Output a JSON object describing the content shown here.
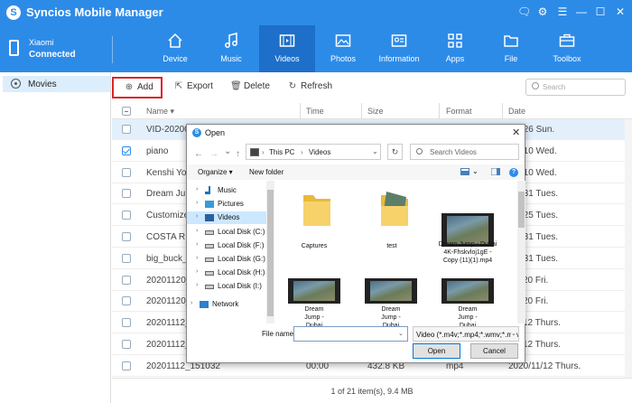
{
  "app": {
    "title": "Syncios Mobile Manager",
    "logo_letter": "S"
  },
  "window_controls": {
    "chat": "🗨",
    "settings": "⚙",
    "menu": "☰",
    "minimize": "—",
    "maximize": "☐",
    "close": "✕"
  },
  "device": {
    "brand": "Xiaomi",
    "status": "Connected"
  },
  "nav": {
    "tabs": [
      {
        "label": "Device",
        "icon": "home-icon"
      },
      {
        "label": "Music",
        "icon": "music-note-icon"
      },
      {
        "label": "Videos",
        "icon": "film-icon"
      },
      {
        "label": "Photos",
        "icon": "image-icon"
      },
      {
        "label": "Information",
        "icon": "contact-card-icon"
      },
      {
        "label": "Apps",
        "icon": "apps-grid-icon"
      },
      {
        "label": "File",
        "icon": "folder-icon"
      },
      {
        "label": "Toolbox",
        "icon": "toolbox-icon"
      }
    ],
    "active": "Videos"
  },
  "sidebar": {
    "items": [
      {
        "label": "Movies",
        "icon": "disc-icon"
      }
    ]
  },
  "toolbar": {
    "add_label": "Add",
    "add_icon": "⊕",
    "export_label": "Export",
    "export_icon": "⇱",
    "delete_label": "Delete",
    "delete_icon": "🗑",
    "refresh_label": "Refresh",
    "refresh_icon": "↻",
    "search_placeholder": "Search"
  },
  "table": {
    "columns": {
      "name": "Name",
      "name_sort": "▾",
      "time": "Time",
      "size": "Size",
      "format": "Format",
      "date": "Date"
    },
    "rows": [
      {
        "name": "VID-20200",
        "time": "",
        "size": "",
        "format": "",
        "date": "/04/26 Sun.",
        "selected": true,
        "checked": false
      },
      {
        "name": "piano",
        "time": "",
        "size": "",
        "format": "",
        "date": "/06/10 Wed.",
        "selected": false,
        "checked": true
      },
      {
        "name": "Kenshi Yon",
        "time": "",
        "size": "",
        "format": "",
        "date": "/06/10 Wed.",
        "selected": false,
        "checked": false
      },
      {
        "name": "Dream Jum",
        "time": "",
        "size": "",
        "format": "",
        "date": "/12/31 Tues.",
        "selected": false,
        "checked": false
      },
      {
        "name": "Customize",
        "time": "",
        "size": "",
        "format": "",
        "date": "/08/25 Tues.",
        "selected": false,
        "checked": false
      },
      {
        "name": "COSTA RIC",
        "time": "",
        "size": "",
        "format": "",
        "date": "/12/31 Tues.",
        "selected": false,
        "checked": false
      },
      {
        "name": "big_buck_b",
        "time": "",
        "size": "",
        "format": "",
        "date": "/12/31 Tues.",
        "selected": false,
        "checked": false
      },
      {
        "name": "20201120_",
        "time": "",
        "size": "",
        "format": "",
        "date": "/11/20 Fri.",
        "selected": false,
        "checked": false
      },
      {
        "name": "20201120_",
        "time": "",
        "size": "",
        "format": "",
        "date": "/11/20 Fri.",
        "selected": false,
        "checked": false
      },
      {
        "name": "20201112_",
        "time": "",
        "size": "",
        "format": "",
        "date": "/11/12 Thurs.",
        "selected": false,
        "checked": false
      },
      {
        "name": "20201112_",
        "time": "",
        "size": "",
        "format": "",
        "date": "/11/12 Thurs.",
        "selected": false,
        "checked": false
      },
      {
        "name": "20201112_151032",
        "time": "00:00",
        "size": "432.8 KB",
        "format": "mp4",
        "date": "2020/11/12 Thurs.",
        "selected": false,
        "checked": false
      }
    ]
  },
  "footer": {
    "summary": "1 of 21 item(s), 9.4 MB"
  },
  "dialog": {
    "title": "Open",
    "back": "←",
    "forward": "→",
    "history": "⌄",
    "up": "↑",
    "path": [
      "This PC",
      "Videos"
    ],
    "path_sep": "›",
    "refresh": "↻",
    "search_placeholder": "Search Videos",
    "organize_label": "Organize ▾",
    "new_folder_label": "New folder",
    "help": "?",
    "tree": [
      {
        "label": "Music",
        "icon": "music-icon"
      },
      {
        "label": "Pictures",
        "icon": "pictures-icon"
      },
      {
        "label": "Videos",
        "icon": "videos-icon",
        "selected": true
      },
      {
        "label": "Local Disk (C:)",
        "icon": "drive-icon"
      },
      {
        "label": "Local Disk (F:)",
        "icon": "drive-icon"
      },
      {
        "label": "Local Disk (G:)",
        "icon": "drive-icon"
      },
      {
        "label": "Local Disk (H:)",
        "icon": "drive-icon"
      },
      {
        "label": "Local Disk (I:)",
        "icon": "drive-icon"
      },
      {
        "label": "Network",
        "icon": "network-icon"
      }
    ],
    "tree_chevron": "›",
    "files": [
      {
        "name": "Captures",
        "kind": "folder"
      },
      {
        "name": "test",
        "kind": "folder-thumb"
      },
      {
        "name": "Dream Jump - Dubai 4K-Fhskvloj1gE - Copy (11)(1).mp4",
        "kind": "video"
      },
      {
        "name": "Dream Jump - Dubai",
        "kind": "video"
      },
      {
        "name": "Dream Jump - Dubai",
        "kind": "video"
      },
      {
        "name": "Dream Jump - Dubai",
        "kind": "video"
      }
    ],
    "file_name_label": "File name:",
    "file_name_value": "",
    "file_type": "Video (*.m4v;*.mp4;*.wmv;*.mkv;*.avi)",
    "dropdown": "⌄",
    "open_label": "Open",
    "cancel_label": "Cancel",
    "close": "✕"
  }
}
